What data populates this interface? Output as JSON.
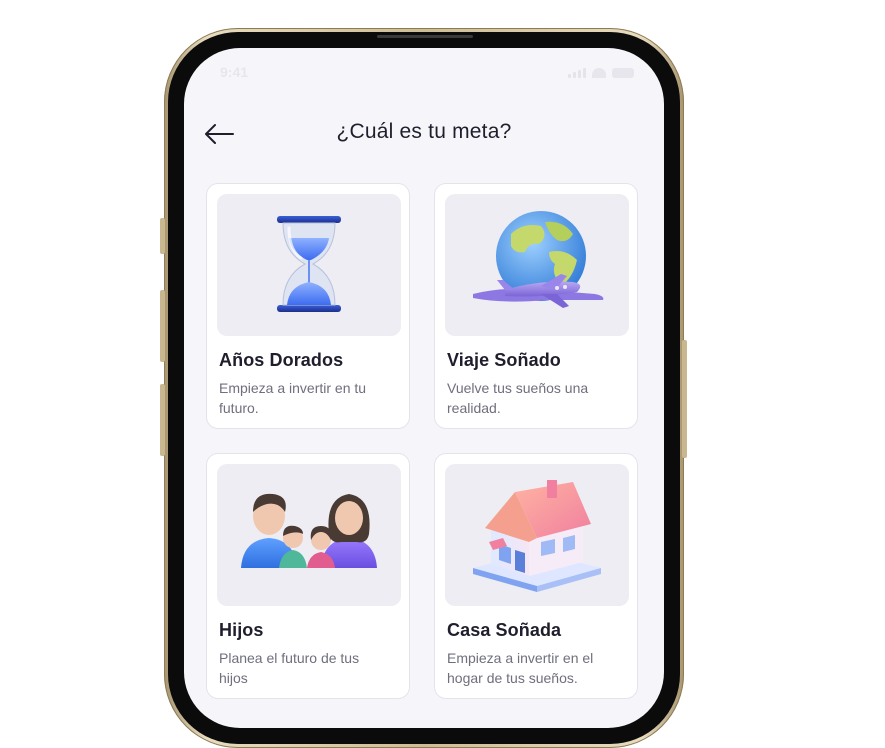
{
  "status_bar": {
    "time": "9:41"
  },
  "header": {
    "title": "¿Cuál es tu meta?"
  },
  "goals": [
    {
      "title": "Años Dorados",
      "description": "Empieza a invertir en tu futuro.",
      "icon": "hourglass-icon"
    },
    {
      "title": "Viaje Soñado",
      "description": "Vuelve tus sueños una realidad.",
      "icon": "globe-airplane-icon"
    },
    {
      "title": "Hijos",
      "description": "Planea el futuro de tus hijos",
      "icon": "family-icon"
    },
    {
      "title": "Casa Soñada",
      "description": "Empieza a invertir en el hogar de tus sueños.",
      "icon": "house-icon"
    }
  ],
  "colors": {
    "screen_background": "#f6f6fa",
    "card_background": "#ffffff",
    "art_background": "#ededf3",
    "title_text": "#1e1e2d",
    "body_text": "#6f6f7d",
    "frame_gold": "#cdbd96"
  }
}
